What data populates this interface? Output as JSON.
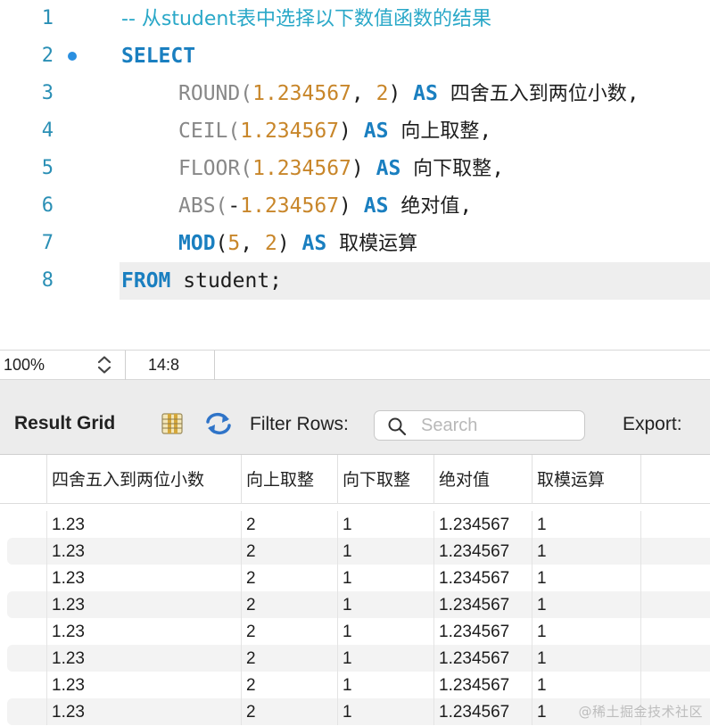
{
  "editor": {
    "line_numbers": [
      "1",
      "2",
      "3",
      "4",
      "5",
      "6",
      "7",
      "8"
    ],
    "l1": {
      "comment": "-- 从student表中选择以下数值函数的结果"
    },
    "l2": {
      "select": "SELECT"
    },
    "l3": {
      "fn": "ROUND",
      "open": "(",
      "arg1": "1.234567",
      "comma": ", ",
      "arg2": "2",
      "close": ")",
      "as": "AS",
      "alias": "四舍五入到两位小数",
      "end": ","
    },
    "l4": {
      "fn": "CEIL",
      "open": "(",
      "arg1": "1.234567",
      "close": ")",
      "as": "AS",
      "alias": "向上取整",
      "end": ","
    },
    "l5": {
      "fn": "FLOOR",
      "open": "(",
      "arg1": "1.234567",
      "close": ")",
      "as": "AS",
      "alias": "向下取整",
      "end": ","
    },
    "l6": {
      "fn": "ABS",
      "open": "(",
      "minus": "-",
      "arg1": "1.234567",
      "close": ")",
      "as": "AS",
      "alias": "绝对值",
      "end": ","
    },
    "l7": {
      "fn": "MOD",
      "open": "(",
      "arg1": "5",
      "comma": ", ",
      "arg2": "2",
      "close": ")",
      "as": "AS",
      "alias": "取模运算"
    },
    "l8": {
      "from": "FROM",
      "table": "student;"
    }
  },
  "statusbar": {
    "zoom": "100%",
    "cursor_position": "14:8"
  },
  "toolbar": {
    "result_grid_label": "Result Grid",
    "filter_label": "Filter Rows:",
    "search_placeholder": "Search",
    "export_label": "Export:"
  },
  "table": {
    "columns": [
      "四舍五入到两位小数",
      "向上取整",
      "向下取整",
      "绝对值",
      "取模运算"
    ],
    "rows": [
      [
        "1.23",
        "2",
        "1",
        "1.234567",
        "1"
      ],
      [
        "1.23",
        "2",
        "1",
        "1.234567",
        "1"
      ],
      [
        "1.23",
        "2",
        "1",
        "1.234567",
        "1"
      ],
      [
        "1.23",
        "2",
        "1",
        "1.234567",
        "1"
      ],
      [
        "1.23",
        "2",
        "1",
        "1.234567",
        "1"
      ],
      [
        "1.23",
        "2",
        "1",
        "1.234567",
        "1"
      ],
      [
        "1.23",
        "2",
        "1",
        "1.234567",
        "1"
      ],
      [
        "1.23",
        "2",
        "1",
        "1.234567",
        "1"
      ]
    ]
  },
  "watermark": "@稀土掘金技术社区",
  "icons": {
    "breakpoint": "breakpoint-dot-icon",
    "stepper": "chevron-up-down-icon",
    "grid": "result-grid-icon",
    "refresh": "refresh-icon",
    "search": "search-icon"
  },
  "colors": {
    "keyword": "#1a7fc0",
    "function": "#888888",
    "number": "#c8862a",
    "comment": "#2aa8c8",
    "line_number": "#2a8fb5",
    "toolbar_bg": "#ececec"
  }
}
